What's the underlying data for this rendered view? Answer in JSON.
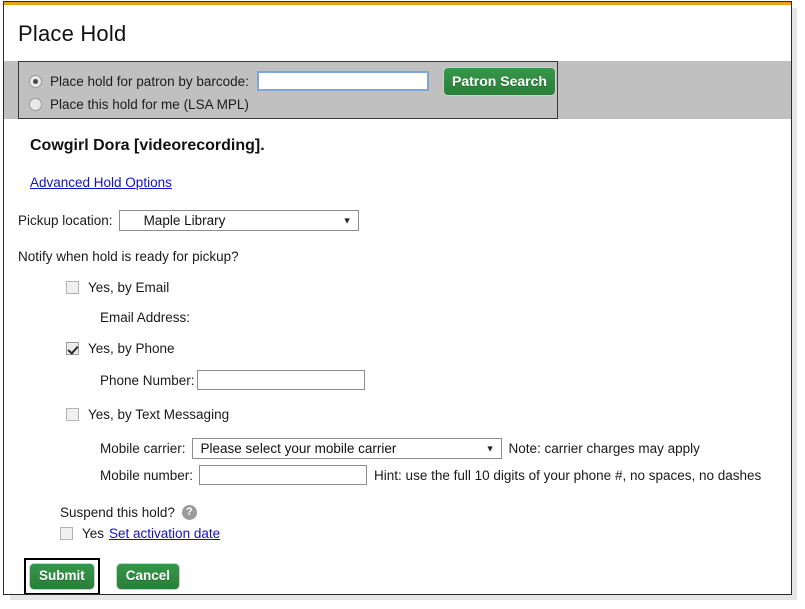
{
  "page": {
    "title": "Place Hold",
    "accent_color": "#e8a317",
    "brand_green": "#2e8b3d",
    "link_color": "#1111cc",
    "band_gray": "#c0c0c0"
  },
  "patron_panel": {
    "options": [
      {
        "label": "Place hold for patron by barcode:",
        "selected": true,
        "icon": "radio-selected"
      },
      {
        "label": "Place this hold for me (LSA MPL)",
        "selected": false,
        "icon": "radio-unselected"
      }
    ],
    "barcode_input": {
      "value": "",
      "placeholder": ""
    },
    "search_button": "Patron Search"
  },
  "record": {
    "item_title": "Cowgirl Dora [videorecording].",
    "advanced_link": "Advanced Hold Options"
  },
  "pickup": {
    "label": "Pickup location:",
    "selected": "Maple Library",
    "arrow_icon": "chevron-down-icon"
  },
  "notify": {
    "question": "Notify when hold is ready for pickup?",
    "email": {
      "label": "Yes, by Email",
      "checked": false,
      "field_label": "Email Address:",
      "value": ""
    },
    "phone": {
      "label": "Yes, by Phone",
      "checked": true,
      "field_label": "Phone Number:",
      "value": ""
    },
    "text": {
      "label": "Yes, by Text Messaging",
      "checked": false,
      "carrier_label": "Mobile carrier:",
      "carrier_selected": "Please select your mobile carrier",
      "carrier_note": "Note: carrier charges may apply",
      "number_label": "Mobile number:",
      "number_value": "",
      "number_hint": "Hint: use the full 10 digits of your phone #, no spaces, no dashes"
    }
  },
  "suspend": {
    "question": "Suspend this hold?",
    "help_icon_glyph": "?",
    "help_icon_name": "help-icon",
    "yes_label": "Yes",
    "yes_checked": false,
    "activation_link": "Set activation date"
  },
  "footer": {
    "submit_label": "Submit",
    "cancel_label": "Cancel",
    "submit_focused": true
  }
}
